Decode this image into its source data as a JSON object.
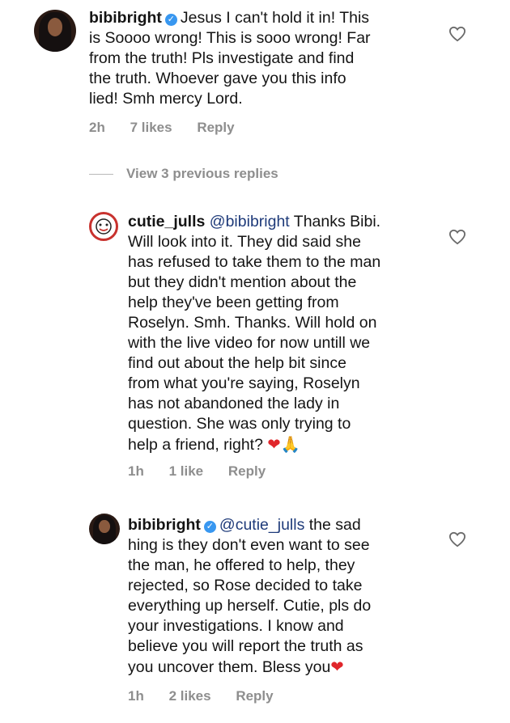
{
  "comments": [
    {
      "username": "bibibright",
      "lines": [
        "Jesus I can't hold it in!  This",
        "is Soooo wrong! This is sooo wrong! Far",
        "from the truth! Pls investigate and find",
        "the truth. Whoever gave you this info",
        "lied! Smh mercy Lord."
      ],
      "time": "2h",
      "likes": "7 likes",
      "reply": "Reply"
    },
    {
      "username": "cutie_julls",
      "mention": "@bibibright",
      "lines": [
        " Thanks Bibi.",
        "Will look into it. They did said she",
        "has refused to take them to the man",
        "but they didn't mention about the",
        "help they've been getting from",
        "Roselyn. Smh. Thanks. Will hold on",
        "with the live video for now untill we",
        "find out about the help bit since",
        "from what you're saying, Roselyn",
        "has not abandoned the lady in",
        "question. She was only trying to",
        "help a friend, right? "
      ],
      "emojis": [
        "❤",
        "🙏"
      ],
      "time": "1h",
      "likes": "1 like",
      "reply": "Reply"
    },
    {
      "username": "bibibright",
      "mention": "@cutie_julls",
      "lines": [
        " the sad",
        "hing is they don't even want to see",
        "the man, he offered to help, they",
        "rejected, so Rose decided to take",
        "everything up herself.  Cutie, pls do",
        "your investigations. I know and",
        "believe you will report the truth as",
        "you uncover them. Bless you"
      ],
      "emojis": [
        "❤"
      ],
      "time": "1h",
      "likes": "2 likes",
      "reply": "Reply"
    }
  ],
  "view_previous_replies": "View 3 previous replies",
  "icons": {
    "heart": "heart-outline-icon",
    "verified": "verified-badge-icon"
  },
  "colors": {
    "text": "#141414",
    "meta": "#8e8e8e",
    "verified": "#3897f0",
    "mention": "#1f3b7a",
    "heart_emoji": "#e0262b"
  }
}
